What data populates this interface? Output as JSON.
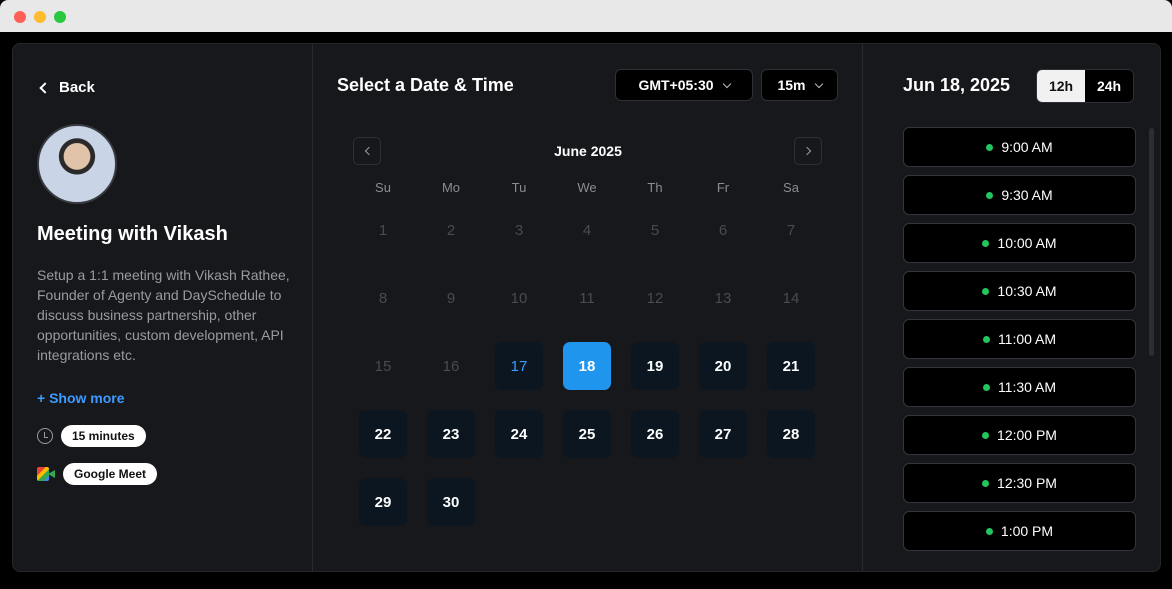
{
  "window": {
    "controls": [
      "close",
      "minimize",
      "maximize"
    ]
  },
  "left": {
    "back_label": "Back",
    "title": "Meeting with Vikash",
    "description": "Setup a 1:1 meeting with Vikash Rathee, Founder of Agenty and DaySchedule to discuss business partnership, other opportunities, custom development, API integrations etc.",
    "show_more": "+ Show more",
    "duration": "15 minutes",
    "location": "Google Meet"
  },
  "middle": {
    "title": "Select a Date & Time",
    "timezone": "GMT+05:30",
    "interval": "15m",
    "month": "June 2025",
    "weekdays": [
      "Su",
      "Mo",
      "Tu",
      "We",
      "Th",
      "Fr",
      "Sa"
    ],
    "days": [
      {
        "n": "1",
        "s": "disabled"
      },
      {
        "n": "2",
        "s": "disabled"
      },
      {
        "n": "3",
        "s": "disabled"
      },
      {
        "n": "4",
        "s": "disabled"
      },
      {
        "n": "5",
        "s": "disabled"
      },
      {
        "n": "6",
        "s": "disabled"
      },
      {
        "n": "7",
        "s": "disabled"
      },
      {
        "n": "8",
        "s": "disabled"
      },
      {
        "n": "9",
        "s": "disabled"
      },
      {
        "n": "10",
        "s": "disabled"
      },
      {
        "n": "11",
        "s": "disabled"
      },
      {
        "n": "12",
        "s": "disabled"
      },
      {
        "n": "13",
        "s": "disabled"
      },
      {
        "n": "14",
        "s": "disabled"
      },
      {
        "n": "15",
        "s": "disabled"
      },
      {
        "n": "16",
        "s": "disabled"
      },
      {
        "n": "17",
        "s": "today"
      },
      {
        "n": "18",
        "s": "selected"
      },
      {
        "n": "19",
        "s": "available"
      },
      {
        "n": "20",
        "s": "available"
      },
      {
        "n": "21",
        "s": "available"
      },
      {
        "n": "22",
        "s": "available"
      },
      {
        "n": "23",
        "s": "available"
      },
      {
        "n": "24",
        "s": "available"
      },
      {
        "n": "25",
        "s": "available"
      },
      {
        "n": "26",
        "s": "available"
      },
      {
        "n": "27",
        "s": "available"
      },
      {
        "n": "28",
        "s": "available"
      },
      {
        "n": "29",
        "s": "available"
      },
      {
        "n": "30",
        "s": "available"
      }
    ]
  },
  "right": {
    "selected_date": "Jun 18, 2025",
    "format_12h": "12h",
    "format_24h": "24h",
    "active_format": "12h",
    "slots": [
      "9:00 AM",
      "9:30 AM",
      "10:00 AM",
      "10:30 AM",
      "11:00 AM",
      "11:30 AM",
      "12:00 PM",
      "12:30 PM",
      "1:00 PM"
    ]
  },
  "colors": {
    "accent": "#1f95ee",
    "available_dot": "#22c55e",
    "link": "#3c9bff"
  }
}
